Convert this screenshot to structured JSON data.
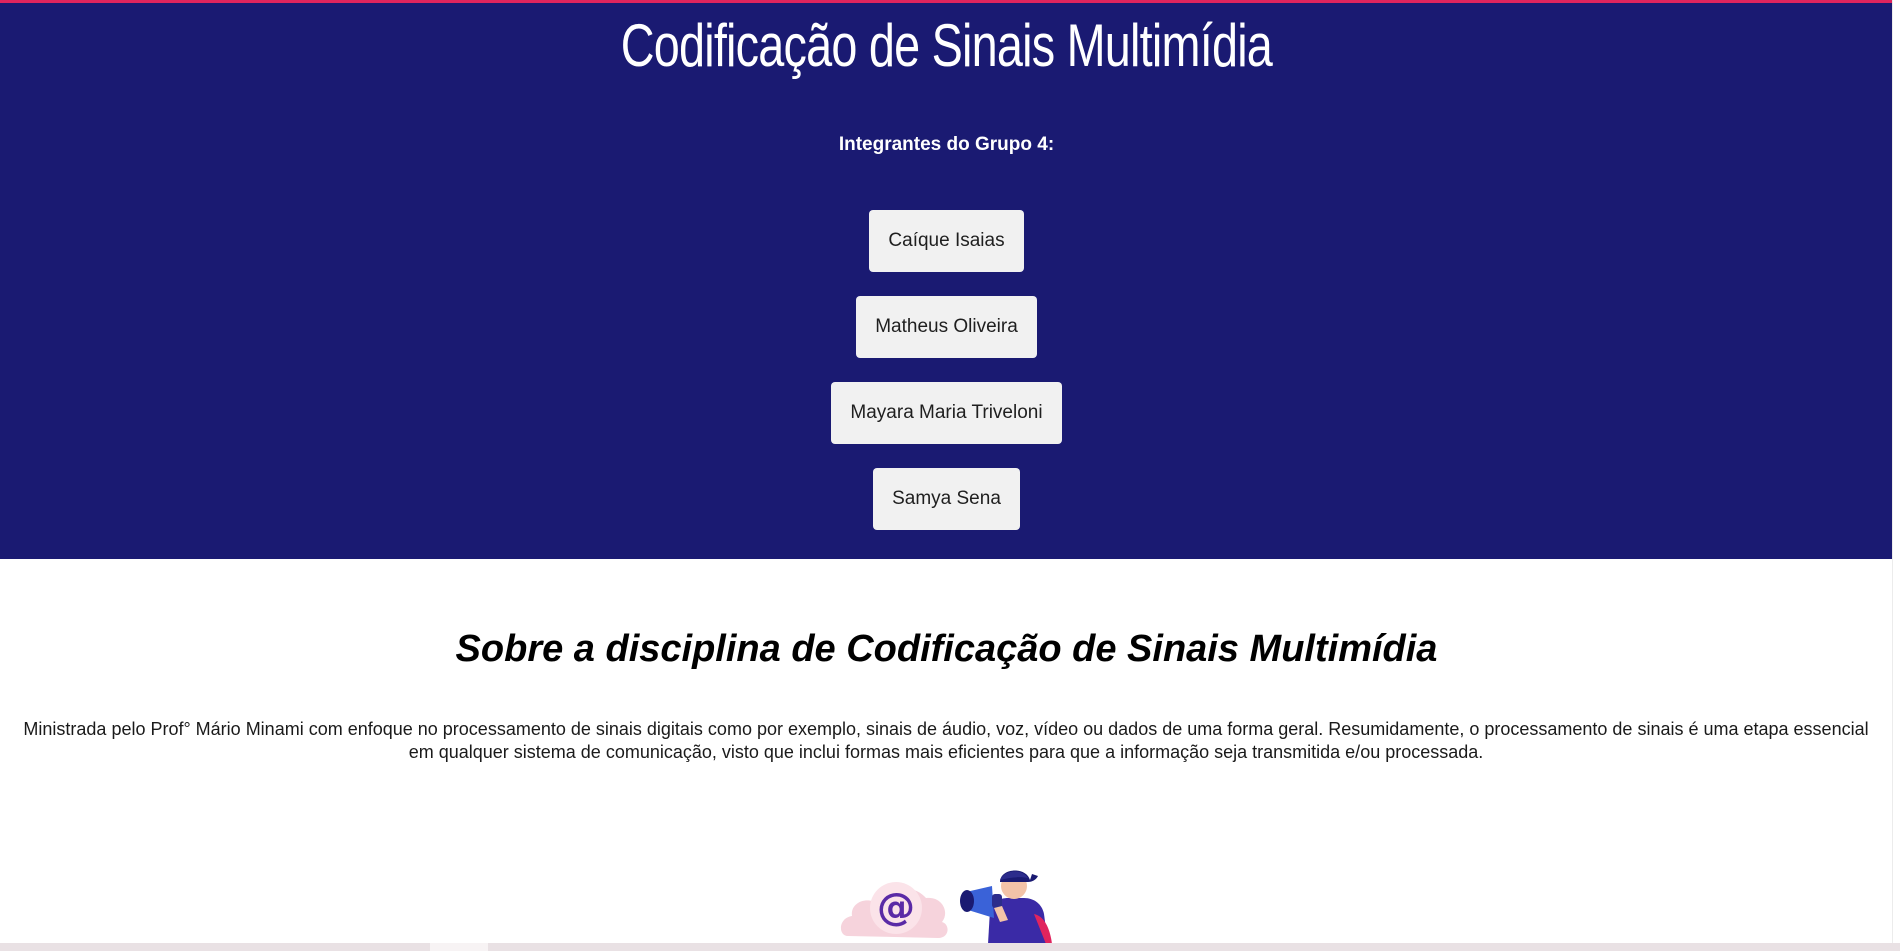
{
  "colors": {
    "hero_background": "#1a1a72",
    "top_accent": "#e0245e"
  },
  "hero": {
    "title": "Codificação de Sinais Multimídia",
    "members_heading": "Integrantes do Grupo 4:",
    "members": [
      "Caíque Isaias",
      "Matheus Oliveira",
      "Mayara Maria Triveloni",
      "Samya Sena"
    ]
  },
  "about": {
    "title": "Sobre a disciplina de Codificação de Sinais Multimídia",
    "text": "Ministrada pelo Prof° Mário Minami com enfoque no processamento de sinais digitais como por exemplo, sinais de áudio, voz, vídeo ou dados de uma forma geral. Resumidamente, o processamento de sinais é uma etapa essencial em qualquer sistema de comunicação, visto que inclui formas mais eficientes para que a informação seja transmitida e/ou processada."
  },
  "illustration": {
    "icon_names": [
      "at-sign-cloud-icon",
      "megaphone-person-icon"
    ],
    "at_symbol": "@"
  }
}
